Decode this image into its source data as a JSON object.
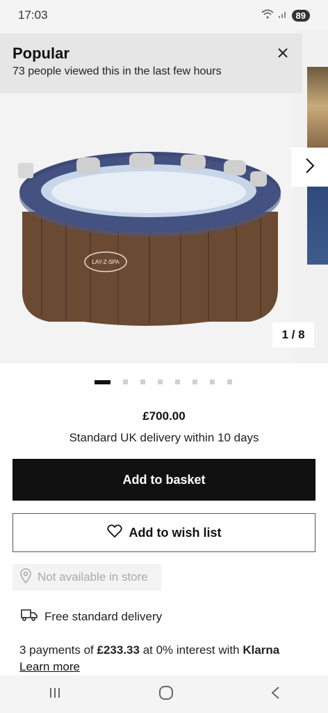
{
  "status_bar": {
    "time": "17:03",
    "battery": "89"
  },
  "popular": {
    "title": "Popular",
    "subtitle": "73 people viewed this in the last few hours"
  },
  "gallery": {
    "brand_on_tub": "LAY-Z-SPA",
    "counter": "1 / 8",
    "dot_count": 8,
    "active_dot": 1
  },
  "product": {
    "price": "£700.00",
    "delivery": "Standard UK delivery within 10 days"
  },
  "actions": {
    "add_to_basket": "Add to basket",
    "add_to_wishlist": "Add to wish list"
  },
  "store": {
    "label": "Not available in store"
  },
  "shipping": {
    "free_delivery": "Free standard delivery"
  },
  "klarna": {
    "prefix": "3 payments of ",
    "amount": "£233.33",
    "middle": " at 0% interest with ",
    "brand": "Klarna",
    "learn_more": "Learn more"
  },
  "colors": {
    "button_dark": "#111111",
    "popular_bg": "#e6e6e6",
    "muted_text": "#aaaaaa"
  },
  "icons": [
    "wifi-icon",
    "signal-icon",
    "close-icon",
    "chevron-right-icon",
    "heart-icon",
    "location-pin-icon",
    "delivery-truck-icon",
    "recent-apps-icon",
    "home-icon",
    "back-icon"
  ]
}
